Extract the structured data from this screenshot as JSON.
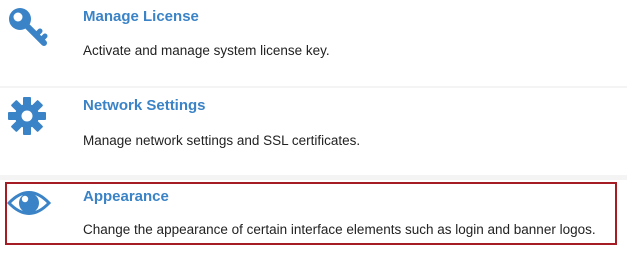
{
  "settings": {
    "items": [
      {
        "title": "Manage License",
        "description": "Activate and manage system license key.",
        "icon": "key-icon"
      },
      {
        "title": "Network Settings",
        "description": "Manage network settings and SSL certificates.",
        "icon": "gear-icon"
      },
      {
        "title": "Appearance",
        "description": "Change the appearance of certain interface elements such as login and banner logos.",
        "icon": "eye-icon",
        "highlighted": true
      }
    ]
  },
  "colors": {
    "accent": "#3a83c7",
    "highlight_border": "#a51c24",
    "text": "#222222"
  }
}
